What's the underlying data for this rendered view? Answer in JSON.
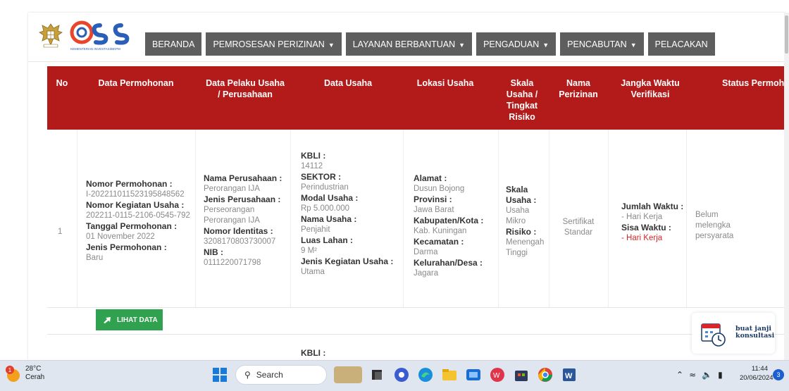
{
  "header": {
    "nav": [
      {
        "label": "BERANDA",
        "dropdown": false
      },
      {
        "label": "PEMROSESAN PERIZINAN",
        "dropdown": true
      },
      {
        "label": "LAYANAN BERBANTUAN",
        "dropdown": true
      },
      {
        "label": "PENGADUAN",
        "dropdown": true
      },
      {
        "label": "PENCABUTAN",
        "dropdown": true
      },
      {
        "label": "PELACAKAN",
        "dropdown": false
      }
    ],
    "logo_text": "OSS",
    "logo_sub": "KEMENTERIAN INVESTASI/BKPM"
  },
  "table": {
    "headers": [
      "No",
      "Data Permohonan",
      "Data Pelaku Usaha / Perusahaan",
      "Data Usaha",
      "Lokasi Usaha",
      "Skala Usaha / Tingkat Risiko",
      "Nama Perizinan",
      "Jangka Waktu Verifikasi",
      "Status Permohon"
    ],
    "row": {
      "no": "1",
      "permohonan": {
        "nomor_label": "Nomor Permohonan :",
        "nomor": "I-202211011523195848562",
        "kegiatan_label": "Nomor Kegiatan Usaha :",
        "kegiatan": "202211-0115-2106-0545-792",
        "tanggal_label": "Tanggal Permohonan :",
        "tanggal": "01 November 2022",
        "jenis_label": "Jenis Permohonan :",
        "jenis": "Baru"
      },
      "pelaku": {
        "nama_label": "Nama Perusahaan :",
        "nama": "Perorangan IJA",
        "jenis_label": "Jenis Perusahaan :",
        "jenis": "Perseorangan",
        "jenis2": "Perorangan IJA",
        "identitas_label": "Nomor Identitas :",
        "identitas": "3208170803730007",
        "nib_label": "NIB :",
        "nib": "0111220071798"
      },
      "usaha": {
        "kbli_label": "KBLI :",
        "kbli": "14112",
        "sektor_label": "SEKTOR :",
        "sektor": "Perindustrian",
        "modal_label": "Modal Usaha :",
        "modal": "Rp 5.000.000",
        "nama_label": "Nama Usaha :",
        "nama": "Penjahit",
        "luas_label": "Luas Lahan :",
        "luas": "9 M²",
        "kegiatan_label": "Jenis Kegiatan Usaha :",
        "kegiatan": "Utama"
      },
      "lokasi": {
        "alamat_label": "Alamat :",
        "alamat": "Dusun Bojong",
        "provinsi_label": "Provinsi :",
        "provinsi": "Jawa Barat",
        "kabupaten_label": "Kabupaten/Kota :",
        "kabupaten": "Kab. Kuningan",
        "kecamatan_label": "Kecamatan :",
        "kecamatan": "Darma",
        "kelurahan_label": "Kelurahan/Desa :",
        "kelurahan": "Jagara"
      },
      "skala": {
        "skala_label1": "Skala",
        "skala_label2": "Usaha :",
        "skala1": "Usaha",
        "skala2": "Mikro",
        "risiko_label": "Risiko :",
        "risiko1": "Menengah",
        "risiko2": "Tinggi"
      },
      "perizinan": {
        "line1": "Sertifikat",
        "line2": "Standar"
      },
      "jangka": {
        "jumlah_label": "Jumlah Waktu :",
        "jumlah": "- Hari Kerja",
        "sisa_label": "Sisa Waktu :",
        "sisa": "- Hari Kerja"
      },
      "status": {
        "line1": "Belum",
        "line2": "melengka",
        "line3": "persyarata"
      }
    },
    "next_row_kbli": "KBLI :",
    "action_label": "LIHAT DATA"
  },
  "konsultasi": {
    "line1": "buat janji",
    "line2": "konsultasi"
  },
  "taskbar": {
    "temp": "28°C",
    "weather": "Cerah",
    "weather_badge": "1",
    "search": "Search",
    "time": "11:44",
    "date": "20/06/2024",
    "notif_count": "3"
  },
  "colors": {
    "table_header": "#b31a1a",
    "nav_bg": "#5e5e5e",
    "action_green": "#2fa14f",
    "red_text": "#d9262b"
  }
}
